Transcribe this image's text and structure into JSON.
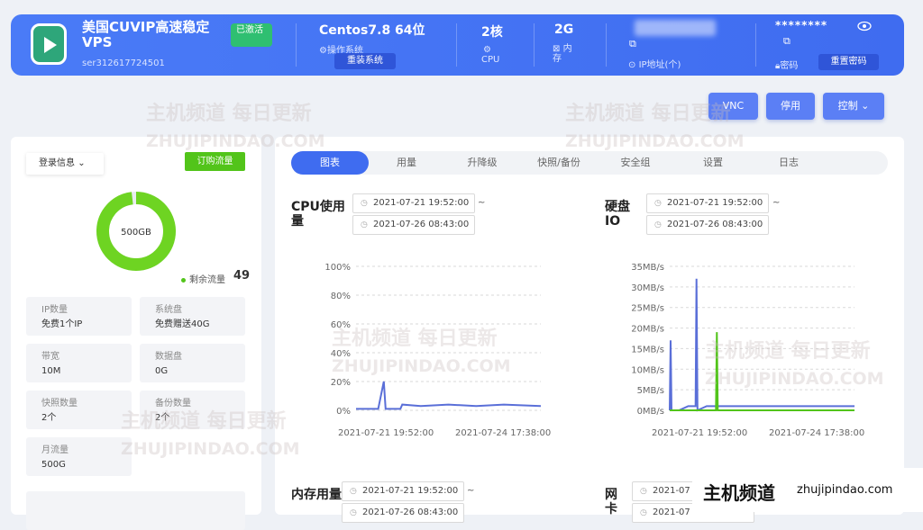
{
  "header": {
    "vps_name": "美国CUVIP高速稳定VPS",
    "vps_id": "ser312617724501",
    "status_badge": "已激活",
    "os_value": "Centos7.8 64位",
    "os_label": "操作系统",
    "reinstall_label": "重装系统",
    "cpu_value": "2核",
    "cpu_label": "CPU",
    "mem_value": "2G",
    "mem_label": "内存",
    "ip_label": "IP地址(个)",
    "password_mask": "********",
    "password_label": "密码",
    "reset_password_label": "重置密码"
  },
  "actions": {
    "vnc": "VNC",
    "stop": "停用",
    "control": "控制"
  },
  "left": {
    "login_dropdown": "登录信息",
    "buy_traffic": "订购流量",
    "donut_center": "500GB",
    "remain_label": "剩余流量",
    "remain_value": "49",
    "cards": [
      {
        "k": "IP数量",
        "v": "免费1个IP"
      },
      {
        "k": "系统盘",
        "v": "免费赠送40G"
      },
      {
        "k": "带宽",
        "v": "10M"
      },
      {
        "k": "数据盘",
        "v": "0G"
      },
      {
        "k": "快照数量",
        "v": "2个"
      },
      {
        "k": "备份数量",
        "v": "2个"
      },
      {
        "k": "月流量",
        "v": "500G"
      }
    ],
    "traffic_fraction": 0.98
  },
  "tabs": [
    "图表",
    "用量",
    "升降级",
    "快照/备份",
    "安全组",
    "设置",
    "日志"
  ],
  "charts": {
    "cpu_title": "CPU使用量",
    "disk_title": "硬盘IO",
    "mem_title": "内存用量",
    "net_title": "网卡",
    "start": "2021-07-21 19:52:00",
    "end": "2021-07-26 08:43:00",
    "end_partial": "2021-07-26 08:43:00",
    "net_start": "2021-07",
    "net_end": "2021-07",
    "tilde": "~"
  },
  "chart_data": [
    {
      "type": "line",
      "title": "CPU使用量",
      "y_ticks": [
        "100%",
        "80%",
        "60%",
        "40%",
        "20%",
        "0%"
      ],
      "x_ticks": [
        "2021-07-21 19:52:00",
        "2021-07-24 17:38:00"
      ],
      "ylim": [
        0,
        100
      ],
      "grid": true,
      "series": [
        {
          "color": "#5a6fd8",
          "points": [
            [
              0,
              1
            ],
            [
              0.07,
              1
            ],
            [
              0.12,
              1
            ],
            [
              0.15,
              20
            ],
            [
              0.16,
              1
            ],
            [
              0.2,
              1
            ],
            [
              0.24,
              1
            ],
            [
              0.25,
              4
            ],
            [
              0.35,
              3
            ],
            [
              0.5,
              4
            ],
            [
              0.65,
              3
            ],
            [
              0.8,
              4
            ],
            [
              1,
              3
            ]
          ]
        }
      ]
    },
    {
      "type": "line",
      "title": "硬盘IO",
      "y_ticks": [
        "35MB/s",
        "30MB/s",
        "25MB/s",
        "20MB/s",
        "15MB/s",
        "10MB/s",
        "5MB/s",
        "0MB/s"
      ],
      "x_ticks": [
        "2021-07-21 19:52:00",
        "2021-07-24 17:38:00"
      ],
      "ylim": [
        0,
        35
      ],
      "grid": true,
      "series": [
        {
          "color": "#5a6fd8",
          "points": [
            [
              0,
              0
            ],
            [
              0.005,
              17
            ],
            [
              0.01,
              0
            ],
            [
              0.05,
              0
            ],
            [
              0.1,
              1
            ],
            [
              0.14,
              1
            ],
            [
              0.145,
              32
            ],
            [
              0.15,
              0
            ],
            [
              0.2,
              1
            ],
            [
              0.3,
              1
            ],
            [
              0.5,
              1
            ],
            [
              0.7,
              1
            ],
            [
              1,
              1
            ]
          ]
        },
        {
          "color": "#52c41a",
          "points": [
            [
              0,
              0
            ],
            [
              0.25,
              0
            ],
            [
              0.255,
              19
            ],
            [
              0.26,
              0
            ],
            [
              1,
              0
            ]
          ]
        }
      ]
    }
  ],
  "footer": {
    "brand": "主机频道",
    "domain": "zhujipindao.com"
  },
  "watermark": {
    "cn": "主机频道 每日更新",
    "en": "ZHUJIPINDAO.COM"
  }
}
